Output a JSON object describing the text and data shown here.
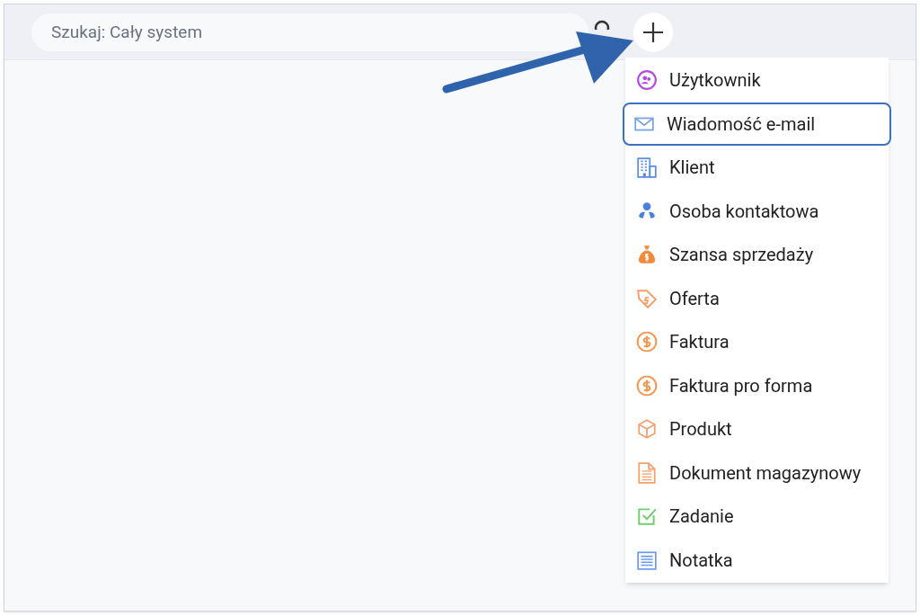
{
  "search": {
    "placeholder": "Szukaj: Cały system"
  },
  "menu": {
    "items": [
      {
        "kind": "user",
        "label": "Użytkownik",
        "selected": false
      },
      {
        "kind": "email",
        "label": "Wiadomość e-mail",
        "selected": true
      },
      {
        "kind": "building",
        "label": "Klient",
        "selected": false
      },
      {
        "kind": "person",
        "label": "Osoba kontaktowa",
        "selected": false
      },
      {
        "kind": "moneybag",
        "label": "Szansa sprzedaży",
        "selected": false
      },
      {
        "kind": "tag",
        "label": "Oferta",
        "selected": false
      },
      {
        "kind": "coin",
        "label": "Faktura",
        "selected": false
      },
      {
        "kind": "coin",
        "label": "Faktura pro forma",
        "selected": false
      },
      {
        "kind": "box",
        "label": "Produkt",
        "selected": false
      },
      {
        "kind": "document",
        "label": "Dokument magazynowy",
        "selected": false
      },
      {
        "kind": "task",
        "label": "Zadanie",
        "selected": false
      },
      {
        "kind": "note",
        "label": "Notatka",
        "selected": false
      }
    ]
  }
}
